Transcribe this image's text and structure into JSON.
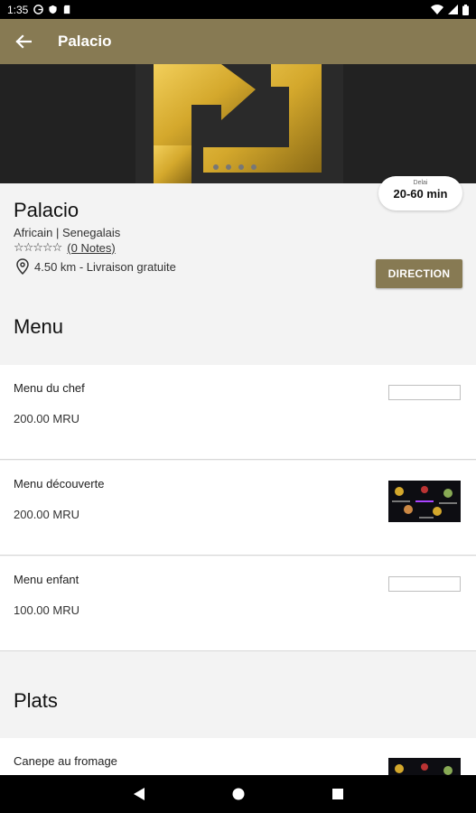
{
  "status_bar": {
    "time": "1:35"
  },
  "app_bar": {
    "title": "Palacio"
  },
  "restaurant": {
    "name": "Palacio",
    "cuisine": "Africain | Senegalais",
    "stars": "☆☆☆☆☆",
    "notes": "(0 Notes)",
    "distance": "4.50 km - Livraison gratuite",
    "delivery_label": "Delai",
    "delivery_time": "20-60 min",
    "direction_label": "DIRECTION"
  },
  "sections": {
    "menu_title": "Menu",
    "plats_title": "Plats"
  },
  "menu_items": [
    {
      "name": "Menu du chef",
      "price": "200.00 MRU"
    },
    {
      "name": "Menu découverte",
      "price": "200.00 MRU"
    },
    {
      "name": "Menu enfant",
      "price": "100.00 MRU"
    }
  ],
  "plats_items": [
    {
      "name": "Canepe au fromage"
    }
  ],
  "colors": {
    "accent": "#877a53",
    "gold": "#d4a82c"
  }
}
